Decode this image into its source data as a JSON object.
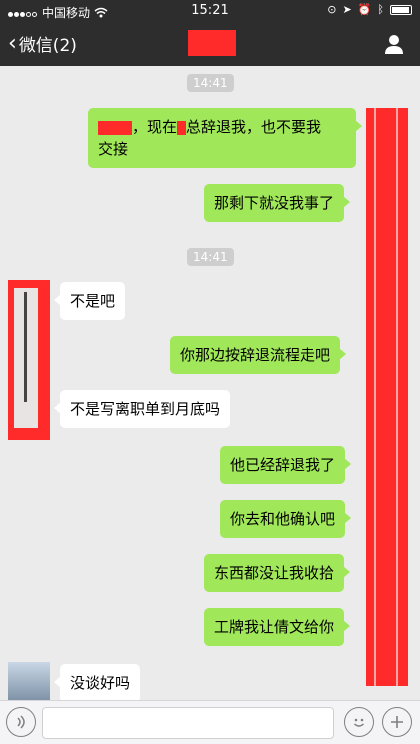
{
  "status_bar": {
    "carrier": "中国移动",
    "time": "15:21",
    "icons": [
      "signal-dots",
      "wifi-icon",
      "lock-rotation-icon",
      "location-icon",
      "alarm-icon",
      "bluetooth-icon",
      "battery-icon"
    ]
  },
  "nav": {
    "back_label": "微信(2)",
    "title": "",
    "right_icon": "person-icon"
  },
  "chat": {
    "timestamps": [
      "14:41",
      "14:41"
    ],
    "messages": [
      {
        "side": "out",
        "text_line1": "，现在",
        "text_line1b": "总辞退我，也不要我",
        "text_line2": "交接"
      },
      {
        "side": "out",
        "text": "那剩下就没我事了"
      },
      {
        "side": "in",
        "text": "不是吧"
      },
      {
        "side": "out",
        "text": "你那边按辞退流程走吧"
      },
      {
        "side": "in",
        "text": "不是写离职单到月底吗"
      },
      {
        "side": "out",
        "text": "他已经辞退我了"
      },
      {
        "side": "out",
        "text": "你去和他确认吧"
      },
      {
        "side": "out",
        "text": "东西都没让我收拾"
      },
      {
        "side": "out",
        "text": "工牌我让倩文给你"
      },
      {
        "side": "in",
        "text": "没谈好吗"
      }
    ]
  },
  "input_bar": {
    "left_icon": "voice-icon",
    "emoji_icon": "emoji-icon",
    "plus_icon": "plus-icon"
  },
  "colors": {
    "bar": "#2d2d2d",
    "background": "#ebebeb",
    "outgoing_bubble": "#a0e75a",
    "incoming_bubble": "#ffffff",
    "redaction": "#ff2a2a"
  }
}
